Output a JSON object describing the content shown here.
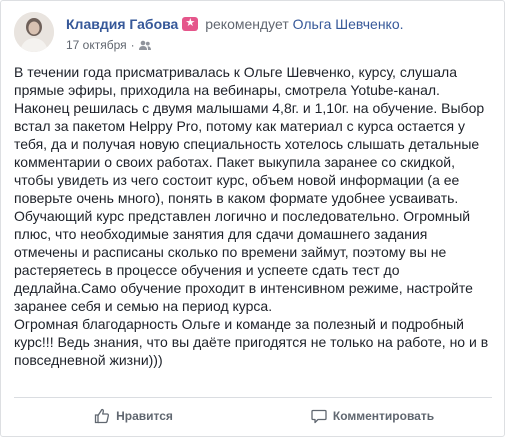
{
  "post": {
    "author": "Клавдия Габова",
    "badge_icon": "star-recommendation-icon",
    "badge_symbol": "★",
    "recommends_text": "рекомендует",
    "target": "Ольга Шевченко.",
    "date": "17 октября",
    "separator": "·",
    "privacy_icon": "friends-icon",
    "body_lines": [
      "В течении года присматривалась к Ольге Шевченко, курсу, слушала",
      "прямые эфиры, приходила на вебинары, смотрела Yotube-канал.",
      "Наконец решилась с двумя малышами 4,8г. и 1,10г. на обучение. Выбор",
      "встал за пакетом Helppy Pro, потому как материал с курса остается у",
      "тебя, да и получая новую специальность хотелось слышать детальные",
      "комментарии о своих работах. Пакет выкупила заранее со скидкой,",
      "чтобы увидеть из чего состоит курс, объем новой информации (а ее",
      "поверьте очень много), понять в каком формате удобнее усваивать.",
      "Обучающий курс представлен логично и последовательно. Огромный",
      "плюс, что необходимые занятия для сдачи домашнего задания",
      "отмечены и расписаны сколько по времени займут, поэтому вы не",
      "растеряетесь в процессе обучения и успеете сдать тест до",
      "дедлайна.Само обучение проходит в интенсивном режиме, настройте",
      "заранее себя и семью на период курса.",
      "Огромная благодарность Ольге и команде за полезный и подробный",
      "курс!!! Ведь знания, что вы даёте пригодятся не только на работе, но и в",
      "повседневной жизни)))"
    ]
  },
  "actions": {
    "like_label": "Нравится",
    "comment_label": "Комментировать"
  },
  "colors": {
    "link": "#365899",
    "muted": "#616770",
    "badge": "#e5568b"
  }
}
